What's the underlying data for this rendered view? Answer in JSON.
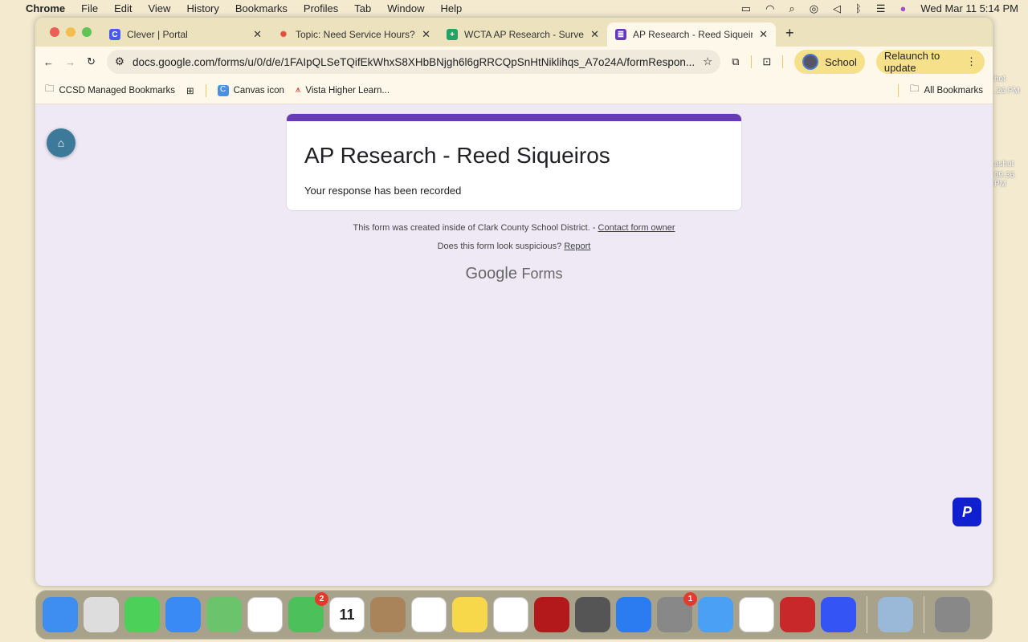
{
  "menubar": {
    "app": "Chrome",
    "items": [
      "File",
      "Edit",
      "View",
      "History",
      "Bookmarks",
      "Profiles",
      "Tab",
      "Window",
      "Help"
    ],
    "clock": "Wed Mar 11  5:14 PM"
  },
  "tabs": [
    {
      "title": "Clever | Portal",
      "icon": "C",
      "color": "#4a5af0"
    },
    {
      "title": "Topic: Need Service Hours?!",
      "icon": "✺",
      "color": "#e64a3b"
    },
    {
      "title": "WCTA AP Research - Survey (",
      "icon": "+",
      "color": "#1fa463"
    },
    {
      "title": "AP Research - Reed Siqueiros",
      "icon": "≣",
      "color": "#673ab7"
    }
  ],
  "toolbar": {
    "url": "docs.google.com/forms/u/0/d/e/1FAIpQLSeTQifEkWhxS8XHbBNjgh6l6gRRCQpSnHtNiklihqs_A7o24A/formRespon...",
    "profile": "School",
    "relaunch": "Relaunch to update"
  },
  "bookmarks": {
    "managed": "CCSD Managed Bookmarks",
    "items": [
      "Canvas icon",
      "Vista Higher Learn..."
    ],
    "all": "All Bookmarks"
  },
  "form": {
    "title": "AP Research - Reed Siqueiros",
    "message": "Your response has been recorded",
    "footer_text": "This form was created inside of Clark County School District. - ",
    "contact": "Contact form owner",
    "suspicious": "Does this form look suspicious? ",
    "report": "Report",
    "logo_google": "Google",
    "logo_forms": "Forms",
    "accent": "#673ab7"
  },
  "desktop": {
    "labels": [
      "hot",
      ".26 PM",
      "ashot",
      "09.36 PM"
    ]
  },
  "dock": {
    "apps": [
      {
        "name": "finder",
        "color": "#3d8ef0"
      },
      {
        "name": "launchpad",
        "color": "#ddd"
      },
      {
        "name": "messages",
        "color": "#4cd05a"
      },
      {
        "name": "mail",
        "color": "#3a8af5"
      },
      {
        "name": "maps",
        "color": "#6bc36b"
      },
      {
        "name": "photos",
        "color": "#fff"
      },
      {
        "name": "facetime",
        "color": "#4cc05a",
        "badge": "2"
      },
      {
        "name": "calendar",
        "color": "#fff",
        "text": "11"
      },
      {
        "name": "contacts",
        "color": "#a9845a"
      },
      {
        "name": "reminders",
        "color": "#fff"
      },
      {
        "name": "notes",
        "color": "#f6d84a"
      },
      {
        "name": "pages",
        "color": "#fff"
      },
      {
        "name": "acrobat",
        "color": "#b3191b"
      },
      {
        "name": "calculator",
        "color": "#555"
      },
      {
        "name": "app-store",
        "color": "#2a7cf0"
      },
      {
        "name": "system-settings",
        "color": "#888",
        "badge": "1"
      },
      {
        "name": "safari",
        "color": "#4aa0f5"
      },
      {
        "name": "chrome",
        "color": "#fff"
      },
      {
        "name": "photo-booth",
        "color": "#c8282a"
      },
      {
        "name": "roblox",
        "color": "#3454f5"
      }
    ]
  }
}
